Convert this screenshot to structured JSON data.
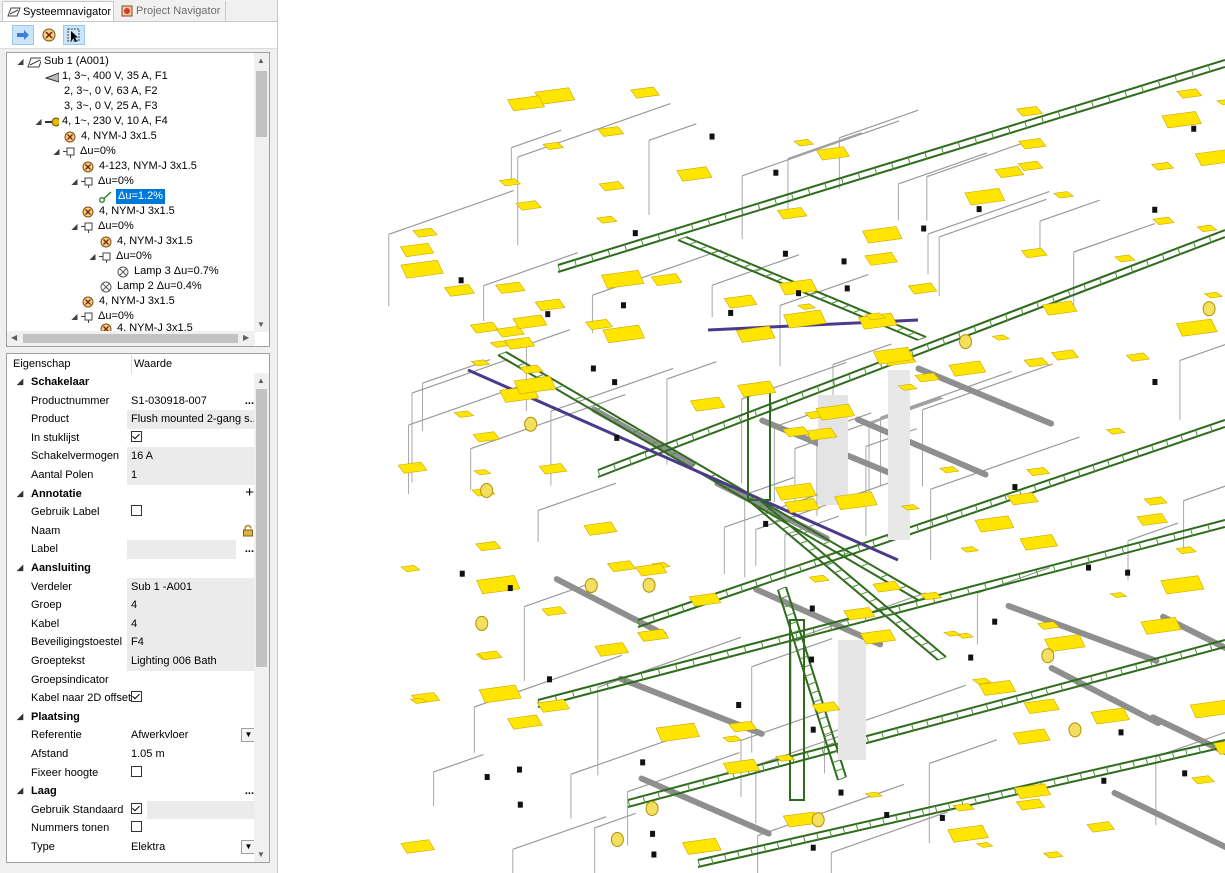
{
  "tabs": {
    "systeem": "Systeemnavigator",
    "project": "Project Navigator"
  },
  "tree": {
    "nodes": [
      {
        "label": "Sub 1 (A001)"
      },
      {
        "label": "1, 3~, 400 V, 35 A, F1"
      },
      {
        "label": "2, 3~, 0 V, 63 A, F2"
      },
      {
        "label": "3, 3~, 0 V, 25 A, F3"
      },
      {
        "label": "4, 1~, 230 V, 10 A, F4"
      },
      {
        "label": "4, NYM-J 3x1.5"
      },
      {
        "label": "Δu=0%"
      },
      {
        "label": "4-123, NYM-J 3x1.5"
      },
      {
        "label": "Δu=0%"
      },
      {
        "label": "Δu=1.2%"
      },
      {
        "label": "4, NYM-J 3x1.5"
      },
      {
        "label": "Δu=0%"
      },
      {
        "label": "4, NYM-J 3x1.5"
      },
      {
        "label": "Δu=0%"
      },
      {
        "label": "Lamp 3 Δu=0.7%"
      },
      {
        "label": "Lamp 2 Δu=0.4%"
      },
      {
        "label": "4, NYM-J 3x1.5"
      },
      {
        "label": "Δu=0%"
      },
      {
        "label": "4, NYM-J 3x1.5"
      }
    ]
  },
  "props": {
    "header_name": "Eigenschap",
    "header_value": "Waarde",
    "schakelaar": {
      "title": "Schakelaar",
      "productnummer_label": "Productnummer",
      "productnummer_value": "S1-030918-007",
      "product_label": "Product",
      "product_value": "Flush mounted 2-gang s...",
      "stuklijst_label": "In stuklijst",
      "schakelvermogen_label": "Schakelvermogen",
      "schakelvermogen_value": "16 A",
      "polen_label": "Aantal Polen",
      "polen_value": "1"
    },
    "annotatie": {
      "title": "Annotatie",
      "gebruik_label": "Gebruik Label",
      "naam_label": "Naam",
      "label_label": "Label"
    },
    "aansluiting": {
      "title": "Aansluiting",
      "verdeler_label": "Verdeler",
      "verdeler_value": "Sub 1 -A001",
      "groep_label": "Groep",
      "groep_value": "4",
      "kabel_label": "Kabel",
      "kabel_value": "4",
      "beveiliging_label": "Beveiligingstoestel",
      "beveiliging_value": "F4",
      "groeptekst_label": "Groeptekst",
      "groeptekst_value": "Lighting  006 Bath",
      "groepsindicator_label": "Groepsindicator",
      "kabel2d_label": "Kabel naar 2D offset"
    },
    "plaatsing": {
      "title": "Plaatsing",
      "referentie_label": "Referentie",
      "referentie_value": "Afwerkvloer",
      "afstand_label": "Afstand",
      "afstand_value": "1.05 m",
      "fixeer_label": "Fixeer hoogte"
    },
    "laag": {
      "title": "Laag",
      "standaard_label": "Gebruik Standaard",
      "nummers_label": "Nummers tonen",
      "type_label": "Type",
      "type_value": "Elektra"
    }
  },
  "colors": {
    "selection": "#0078d7",
    "tray_green": "#2e6b1c",
    "fixture_yellow": "#ffe500",
    "duct_purple": "#4b3a8c"
  }
}
